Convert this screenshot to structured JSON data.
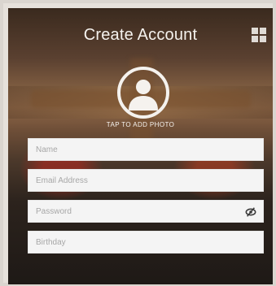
{
  "header": {
    "title": "Create Account"
  },
  "icons": {
    "menu": "grid-icon",
    "avatar": "person-icon",
    "password_toggle": "eye-slash-icon"
  },
  "photo": {
    "label": "TAP TO ADD PHOTO"
  },
  "form": {
    "name": {
      "placeholder": "Name",
      "value": ""
    },
    "email": {
      "placeholder": "Email Address",
      "value": ""
    },
    "password": {
      "placeholder": "Password",
      "value": ""
    },
    "birthday": {
      "placeholder": "Birthday",
      "value": ""
    }
  },
  "colors": {
    "title_text": "#f5f2ee",
    "field_bg": "#f4f4f4",
    "placeholder": "#a7a7a7"
  }
}
